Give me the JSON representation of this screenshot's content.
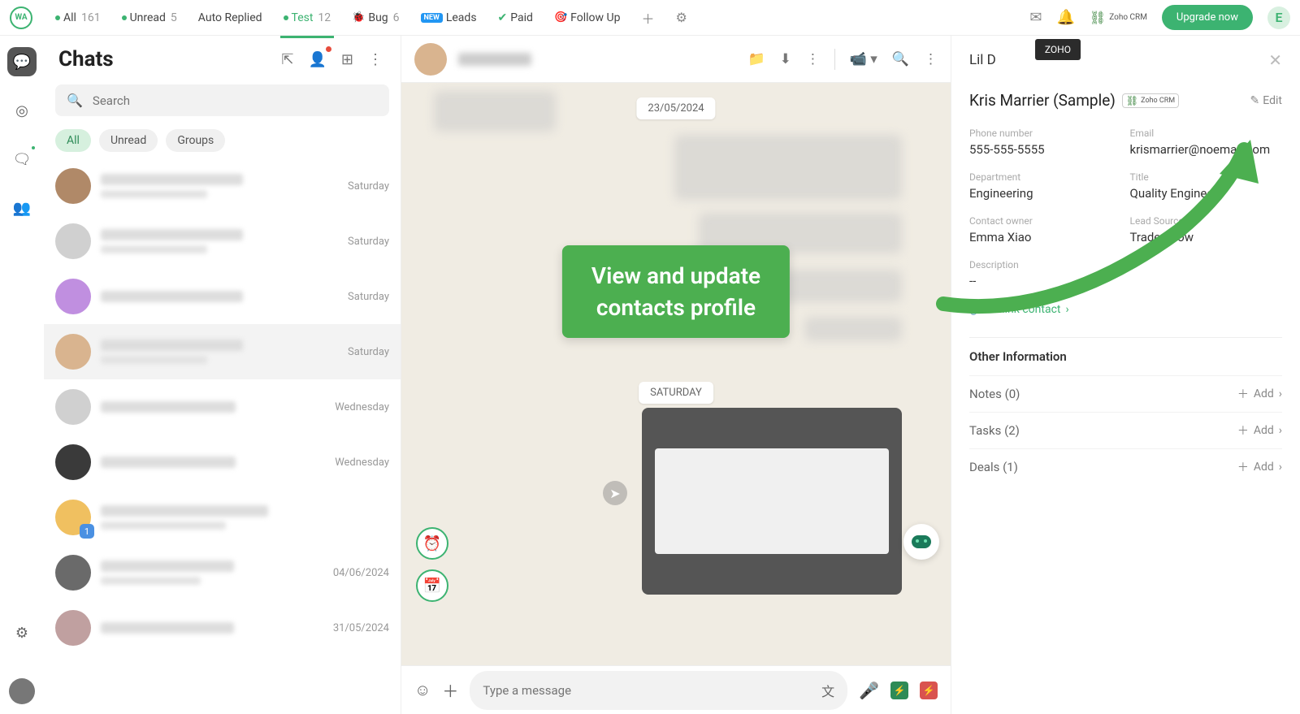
{
  "topbar": {
    "tabs": [
      {
        "label": "All",
        "count": "161",
        "dot": true
      },
      {
        "label": "Unread",
        "count": "5",
        "dot": true
      },
      {
        "label": "Auto Replied",
        "count": ""
      },
      {
        "label": "Test",
        "count": "12",
        "active": true,
        "dot": true
      },
      {
        "label": "Bug",
        "count": "6",
        "emoji": "🐞"
      },
      {
        "label": "Leads",
        "count": "",
        "badge": "NEW"
      },
      {
        "label": "Paid",
        "count": "",
        "check": true
      },
      {
        "label": "Follow Up",
        "count": "",
        "emoji": "🎯"
      }
    ],
    "crm_label": "Zoho CRM",
    "upgrade": "Upgrade now",
    "user_initial": "E",
    "tooltip": "ZOHO"
  },
  "chatlist": {
    "title": "Chats",
    "search_placeholder": "Search",
    "filters": [
      "All",
      "Unread",
      "Groups"
    ],
    "items": [
      {
        "time": "Saturday"
      },
      {
        "time": "Saturday"
      },
      {
        "time": "Saturday"
      },
      {
        "time": "Saturday",
        "selected": true
      },
      {
        "time": "Wednesday"
      },
      {
        "time": "Wednesday"
      },
      {
        "time": "",
        "badge": "1"
      },
      {
        "time": "04/06/2024"
      },
      {
        "time": "31/05/2024"
      }
    ]
  },
  "convo": {
    "date1": "23/05/2024",
    "date2": "SATURDAY",
    "input_placeholder": "Type a message"
  },
  "callout": {
    "line1": "View and update",
    "line2": "contacts profile"
  },
  "rpanel": {
    "header_name": "Lil D",
    "contact_name": "Kris Marrier (Sample)",
    "crm_label": "Zoho CRM",
    "edit": "Edit",
    "fields": {
      "phone_label": "Phone number",
      "phone": "555-555-5555",
      "email_label": "Email",
      "email": "krismarrier@noemail.com",
      "dept_label": "Department",
      "dept": "Engineering",
      "title_label": "Title",
      "title": "Quality Engineer",
      "owner_label": "Contact owner",
      "owner": "Emma Xiao",
      "source_label": "Lead Source",
      "source": "Trade Show",
      "desc_label": "Description",
      "desc": "--"
    },
    "unlink": "Unlink contact",
    "other_info": "Other Information",
    "sections": [
      {
        "label": "Notes (0)",
        "add": "Add"
      },
      {
        "label": "Tasks (2)",
        "add": "Add"
      },
      {
        "label": "Deals (1)",
        "add": "Add"
      }
    ]
  }
}
